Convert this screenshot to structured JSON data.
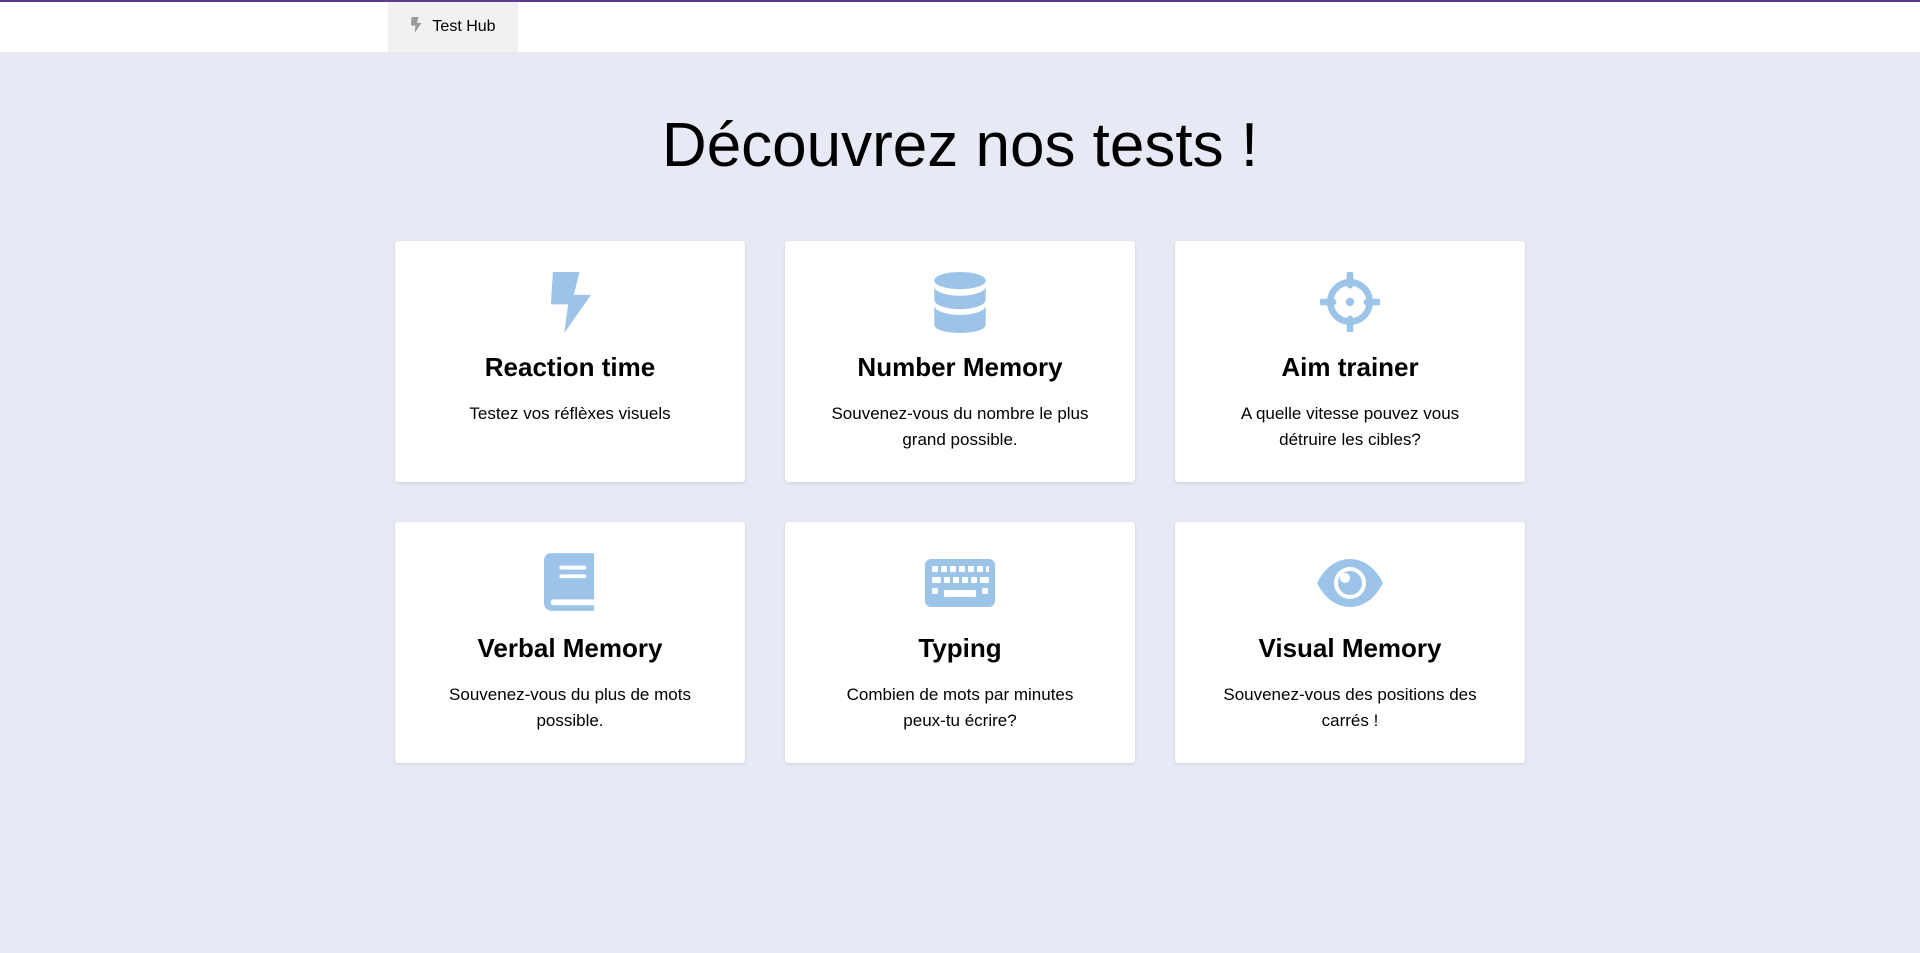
{
  "nav": {
    "brand_label": "Test Hub",
    "brand_icon": "bolt-icon"
  },
  "page": {
    "title": "Découvrez nos tests !"
  },
  "colors": {
    "accent_icon": "#9cc4e9",
    "background": "#e7e9f4",
    "top_border": "#5b3f8e"
  },
  "cards": [
    {
      "title": "Reaction time",
      "description": "Testez vos réflèxes visuels",
      "icon": "bolt-icon"
    },
    {
      "title": "Number Memory",
      "description": "Souvenez-vous du nombre le plus grand possible.",
      "icon": "database-icon"
    },
    {
      "title": "Aim trainer",
      "description": "A quelle vitesse pouvez vous détruire les cibles?",
      "icon": "crosshair-icon"
    },
    {
      "title": "Verbal Memory",
      "description": "Souvenez-vous du plus de mots possible.",
      "icon": "book-icon"
    },
    {
      "title": "Typing",
      "description": "Combien de mots par minutes peux-tu écrire?",
      "icon": "keyboard-icon"
    },
    {
      "title": "Visual Memory",
      "description": "Souvenez-vous des positions des carrés !",
      "icon": "eye-icon"
    }
  ]
}
